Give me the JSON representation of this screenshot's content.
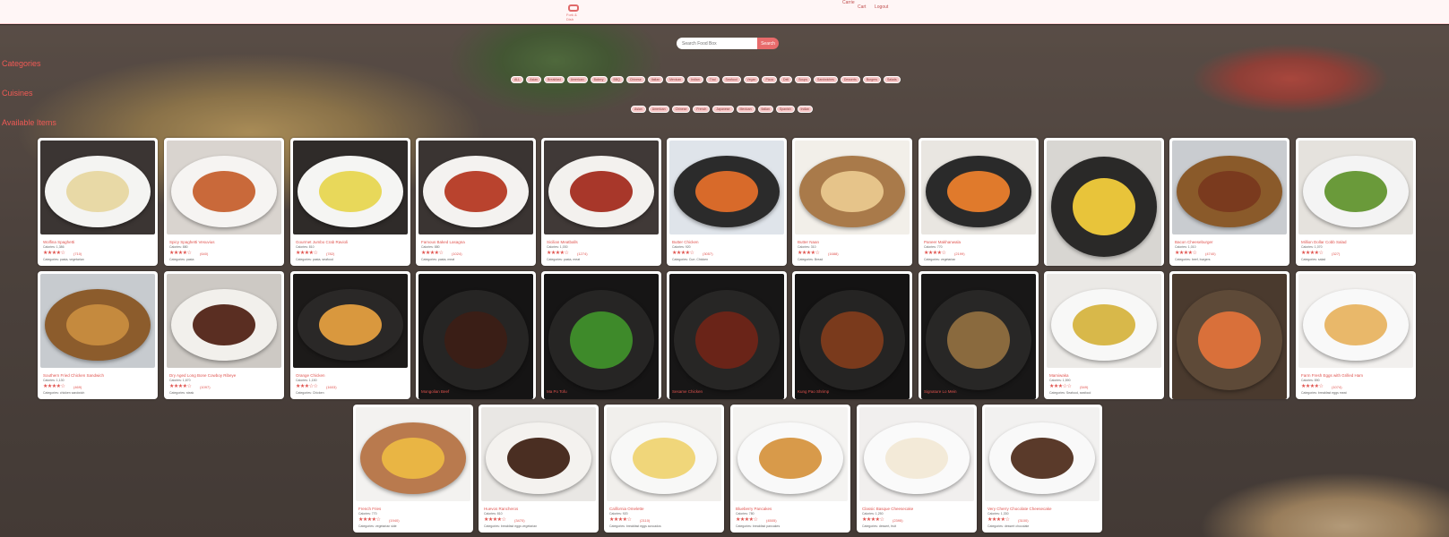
{
  "header": {
    "logo_caption": "Fork & Dish",
    "user_name": "Carrie",
    "cart_label": "Cart",
    "logout_label": "Logout"
  },
  "search": {
    "placeholder": "Search Food Box",
    "button_label": "Search"
  },
  "sidebar": {
    "categories_label": "Categories",
    "cuisines_label": "Cuisines",
    "available_label": "Available Items"
  },
  "category_chips": [
    "ALL",
    "Asian",
    "Breakfast",
    "American",
    "Bakery",
    "BBQ",
    "Chinese",
    "Italian",
    "Mexican",
    "Indian",
    "Thai",
    "Seafood",
    "Vegan",
    "Pizza",
    "Deli",
    "Soups",
    "Sandwiches",
    "Desserts",
    "Burgers",
    "Salads"
  ],
  "cuisine_chips": [
    "Asian",
    "American",
    "Chinese",
    "French",
    "Japanese",
    "Mexican",
    "Italian",
    "Spanish",
    "Indian"
  ],
  "colors": {
    "accent": "#e0534e",
    "chip_bg": "#f6c6c6",
    "header_bg": "#fff6f6"
  },
  "items": [
    {
      "name": "Wolfina Spaghetti",
      "calories": "Calories: 1,386",
      "stars": "★★★★☆",
      "reviews": "(710)",
      "categories": "Categories: pasta, vegetarian",
      "img": "spaghetti"
    },
    {
      "name": "Spicy Spaghetti Vesuvius",
      "calories": "Calories: 880",
      "stars": "★★★★☆",
      "reviews": "(640)",
      "categories": "Categories: pasta",
      "img": "spicy-pasta"
    },
    {
      "name": "Gourmet Jumbo Crab Ravioli",
      "calories": "Calories: 810",
      "stars": "★★★★☆",
      "reviews": "(782)",
      "categories": "Categories: pasta, seafood",
      "img": "ravioli"
    },
    {
      "name": "Famous Baked Lasagna",
      "calories": "Calories: 880",
      "stars": "★★★★☆",
      "reviews": "(1024)",
      "categories": "Categories: pasta, meat",
      "img": "lasagna"
    },
    {
      "name": "Sicilian Meatballs",
      "calories": "Calories: 1,030",
      "stars": "★★★★☆",
      "reviews": "(1274)",
      "categories": "Categories: pasta, meat",
      "img": "meatballs"
    },
    {
      "name": "Butter Chicken",
      "calories": "Calories: 920",
      "stars": "★★★★☆",
      "reviews": "(3057)",
      "categories": "Categories: Curr, Chicken",
      "img": "butter-chicken"
    },
    {
      "name": "Butter Naan",
      "calories": "Calories: 310",
      "stars": "★★★★☆",
      "reviews": "(1688)",
      "categories": "Categories: Bread",
      "img": "naan"
    },
    {
      "name": "Paneer Makhanwala",
      "calories": "Calories: 770",
      "stars": "★★★★☆",
      "reviews": "(2199)",
      "categories": "Categories: vegetarian",
      "img": "paneer"
    },
    {
      "name": "",
      "calories": "",
      "stars": "",
      "reviews": "",
      "categories": "",
      "img": "curry-plate",
      "tall": true
    },
    {
      "name": "Bacon Cheeseburger",
      "calories": "Calories: 1,010",
      "stars": "★★★★☆",
      "reviews": "(4740)",
      "categories": "Categories: beef, burgers",
      "img": "burger"
    },
    {
      "name": "Million Dollar Cobb Salad",
      "calories": "Calories: 1,070",
      "stars": "★★★★☆",
      "reviews": "(327)",
      "categories": "Categories: salad",
      "img": "salad"
    },
    {
      "name": "Southern Fried Chicken Sandwich",
      "calories": "Calories: 1,130",
      "stars": "★★★★☆",
      "reviews": "(469)",
      "categories": "Categories: chicken sandwich",
      "img": "chicken-burger"
    },
    {
      "name": "Dry Aged Long Bone Cowboy Ribeye",
      "calories": "Calories: 1,670",
      "stars": "★★★★☆",
      "reviews": "(1097)",
      "categories": "Categories: steak",
      "img": "steak"
    },
    {
      "name": "Orange Chicken",
      "calories": "Calories: 1,150",
      "stars": "★★★☆☆",
      "reviews": "(1603)",
      "categories": "Categories: Chicken",
      "img": "orange-chicken"
    },
    {
      "name": "Mongolian Beef",
      "calories": "",
      "stars": "",
      "reviews": "",
      "categories": "",
      "img": "mongolian-beef",
      "tall": true
    },
    {
      "name": "Ma Po Tofu",
      "calories": "",
      "stars": "",
      "reviews": "",
      "categories": "",
      "img": "mapo-tofu",
      "tall": true
    },
    {
      "name": "Sesame Chicken",
      "calories": "",
      "stars": "",
      "reviews": "",
      "categories": "",
      "img": "sesame-chicken",
      "tall": true
    },
    {
      "name": "Kung Pao Shrimp",
      "calories": "",
      "stars": "",
      "reviews": "",
      "categories": "",
      "img": "kung-pao",
      "tall": true
    },
    {
      "name": "Signature Lo Mein",
      "calories": "",
      "stars": "",
      "reviews": "",
      "categories": "",
      "img": "lo-mein",
      "tall": true
    },
    {
      "name": "Mamiwaka",
      "calories": "Calories: 1,590",
      "stars": "★★★☆☆",
      "reviews": "(549)",
      "categories": "Categories: Seafood, seafood",
      "img": "tuna"
    },
    {
      "name": "",
      "calories": "",
      "stars": "",
      "reviews": "",
      "categories": "",
      "img": "paella",
      "tall": true
    },
    {
      "name": "Farm Fresh Eggs with Grilled Ham",
      "calories": "Calories: 890",
      "stars": "★★★★☆",
      "reviews": "(1074)",
      "categories": "Categories: breakfast eggs meat",
      "img": "eggs-ham"
    },
    {
      "name": "French Fries",
      "calories": "Calories: 770",
      "stars": "★★★★☆",
      "reviews": "(1940)",
      "categories": "Categories: vegetarian side",
      "img": "fries"
    },
    {
      "name": "Huevos Rancheros",
      "calories": "Calories: 810",
      "stars": "★★★★☆",
      "reviews": "(3470)",
      "categories": "Categories: breakfast eggs vegetarian",
      "img": "huevos"
    },
    {
      "name": "California Omelette",
      "calories": "Calories: 920",
      "stars": "★★★★☆",
      "reviews": "(2110)",
      "categories": "Categories: breakfast eggs avocados",
      "img": "omelette"
    },
    {
      "name": "Blueberry Pancakes",
      "calories": "Calories: 780",
      "stars": "★★★★☆",
      "reviews": "(4505)",
      "categories": "Categories: breakfast pancakes",
      "img": "pancakes"
    },
    {
      "name": "Classic Basque Cheesecake",
      "calories": "Calories: 1,250",
      "stars": "★★★★☆",
      "reviews": "(2395)",
      "categories": "Categories: dessert, fruit",
      "img": "cheesecake"
    },
    {
      "name": "Very Cherry Chocolate Cheesecake",
      "calories": "Calories: 1,330",
      "stars": "★★★★☆",
      "reviews": "(3100)",
      "categories": "Categories: dessert chocolate",
      "img": "choc-cheesecake"
    }
  ]
}
